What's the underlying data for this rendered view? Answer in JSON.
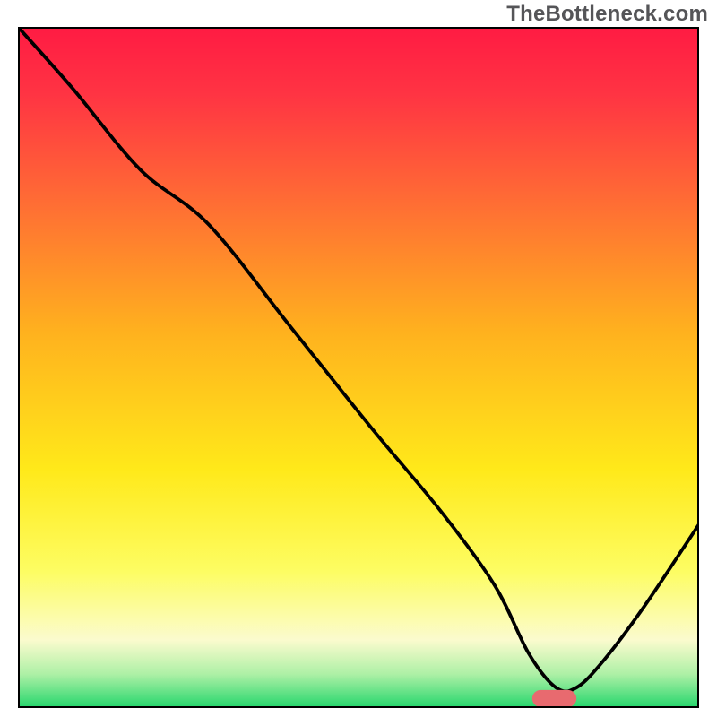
{
  "watermark": "TheBottleneck.com",
  "chart_data": {
    "type": "line",
    "title": "",
    "xlabel": "",
    "ylabel": "",
    "xlim": [
      0,
      100
    ],
    "ylim": [
      0,
      100
    ],
    "grid": false,
    "legend": false,
    "background": {
      "type": "vertical-gradient",
      "stops": [
        {
          "pos": 0.0,
          "color": "#ff1b43"
        },
        {
          "pos": 0.1,
          "color": "#ff3443"
        },
        {
          "pos": 0.25,
          "color": "#ff6a35"
        },
        {
          "pos": 0.45,
          "color": "#ffb21e"
        },
        {
          "pos": 0.65,
          "color": "#ffe91a"
        },
        {
          "pos": 0.8,
          "color": "#fdfd63"
        },
        {
          "pos": 0.9,
          "color": "#fbfbce"
        },
        {
          "pos": 0.95,
          "color": "#aef0a6"
        },
        {
          "pos": 1.0,
          "color": "#24d66c"
        }
      ]
    },
    "series": [
      {
        "name": "bottleneck-curve",
        "color": "#000000",
        "x": [
          0,
          8,
          18,
          28,
          40,
          52,
          62,
          70,
          75,
          79,
          82,
          86,
          92,
          100
        ],
        "y": [
          100,
          91,
          79,
          71,
          56,
          41,
          29,
          18,
          8,
          3,
          3,
          7,
          15,
          27
        ]
      }
    ],
    "marker": {
      "name": "optimal-range",
      "shape": "rounded-bar",
      "color": "#e86a6f",
      "x_range": [
        75.5,
        82
      ],
      "y": 1.4,
      "height": 2.5
    }
  }
}
